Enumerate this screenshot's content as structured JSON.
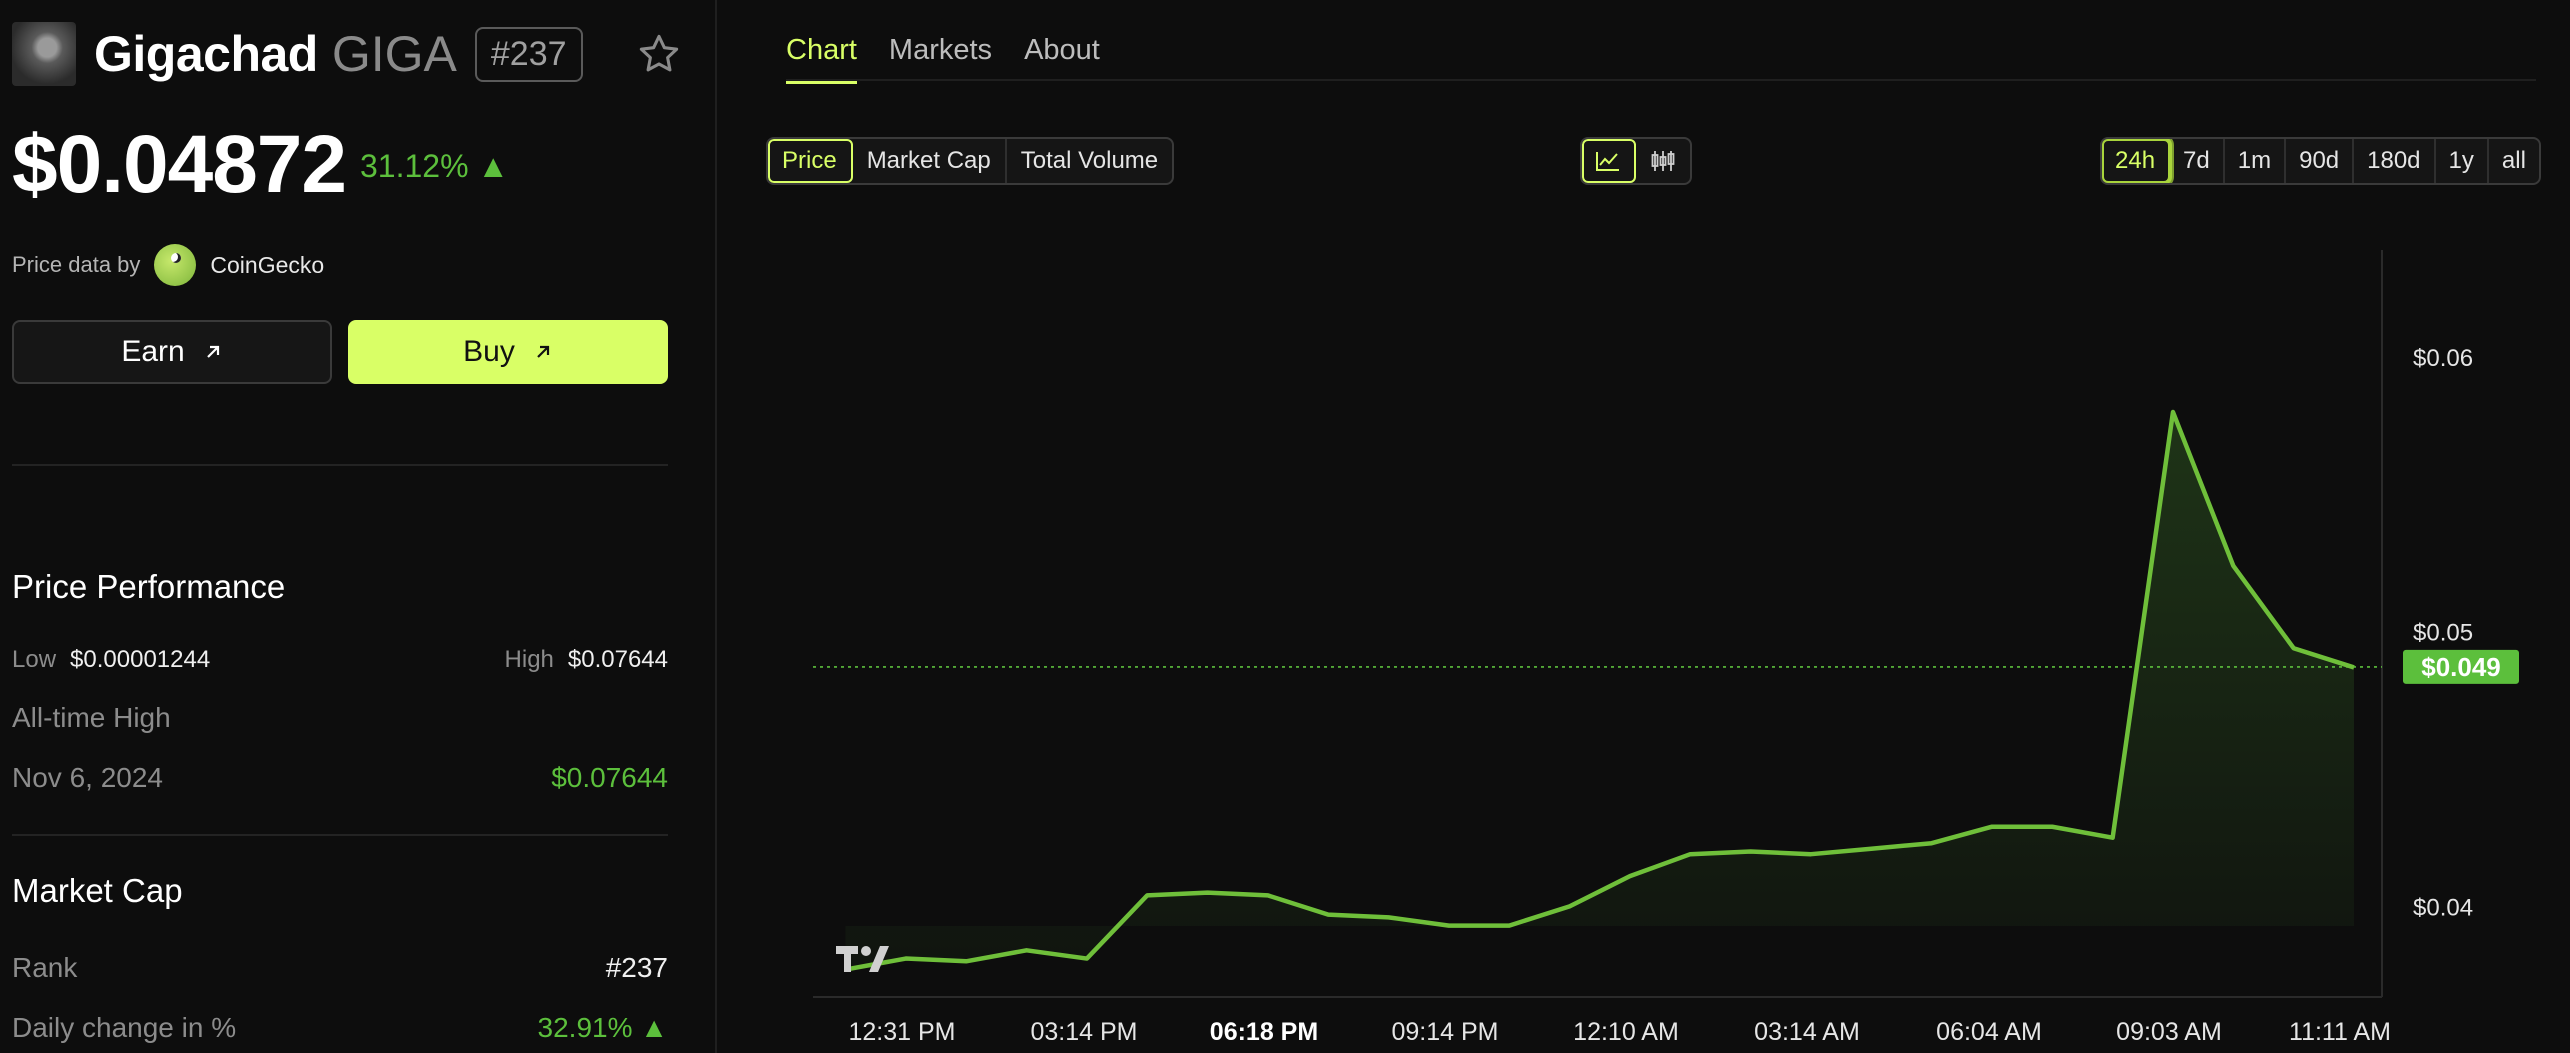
{
  "coin": {
    "name": "Gigachad",
    "symbol": "GIGA",
    "rank_badge": "#237",
    "price": "$0.04872",
    "change": "31.12% ▲",
    "provider_label": "Price data by",
    "provider_name": "CoinGecko"
  },
  "actions": {
    "earn_label": "Earn",
    "buy_label": "Buy"
  },
  "performance": {
    "title": "Price Performance",
    "low_label": "Low",
    "low_value": "$0.00001244",
    "high_label": "High",
    "high_value": "$0.07644",
    "ath_label": "All-time High",
    "ath_date": "Nov 6, 2024",
    "ath_value": "$0.07644"
  },
  "market_cap": {
    "title": "Market Cap",
    "rank_label": "Rank",
    "rank_value": "#237",
    "daily_label": "Daily change in %",
    "daily_value": "32.91% ▲"
  },
  "tabs": [
    {
      "label": "Chart",
      "active": true
    },
    {
      "label": "Markets",
      "active": false
    },
    {
      "label": "About",
      "active": false
    }
  ],
  "metrics": [
    {
      "label": "Price",
      "active": true
    },
    {
      "label": "Market Cap",
      "active": false
    },
    {
      "label": "Total Volume",
      "active": false
    }
  ],
  "chart_types": [
    {
      "icon": "line-chart-icon",
      "active": true
    },
    {
      "icon": "candlestick-icon",
      "active": false
    }
  ],
  "ranges": [
    {
      "label": "24h",
      "active": true
    },
    {
      "label": "7d",
      "active": false
    },
    {
      "label": "1m",
      "active": false
    },
    {
      "label": "90d",
      "active": false
    },
    {
      "label": "180d",
      "active": false
    },
    {
      "label": "1y",
      "active": false
    },
    {
      "label": "all",
      "active": false
    }
  ],
  "colors": {
    "accent": "#d9ff66",
    "up": "#5cbf3c",
    "line": "#6fbf3a",
    "background": "#0d0d0d"
  },
  "chart_data": {
    "type": "area",
    "x_tick_labels": [
      "12:31 PM",
      "03:14 PM",
      "06:18 PM",
      "09:14 PM",
      "12:10 AM",
      "03:14 AM",
      "06:04 AM",
      "09:03 AM",
      "11:11 AM"
    ],
    "x_tick_bold": "06:18 PM",
    "y_ticks": [
      {
        "value": 0.04,
        "label": "$0.04"
      },
      {
        "value": 0.05,
        "label": "$0.05"
      },
      {
        "value": 0.06,
        "label": "$0.06"
      }
    ],
    "ylim": [
      0.0367,
      0.0639
    ],
    "current_value": 0.04872,
    "current_label": "$0.049",
    "grid": false,
    "values": [
      0.0377,
      0.0381,
      0.038,
      0.0384,
      0.0381,
      0.0404,
      0.0405,
      0.0404,
      0.0397,
      0.0396,
      0.0393,
      0.0393,
      0.04,
      0.0411,
      0.0419,
      0.042,
      0.0419,
      0.0421,
      0.0423,
      0.0429,
      0.0429,
      0.0425,
      0.058,
      0.0524,
      0.0494,
      0.0487
    ]
  }
}
